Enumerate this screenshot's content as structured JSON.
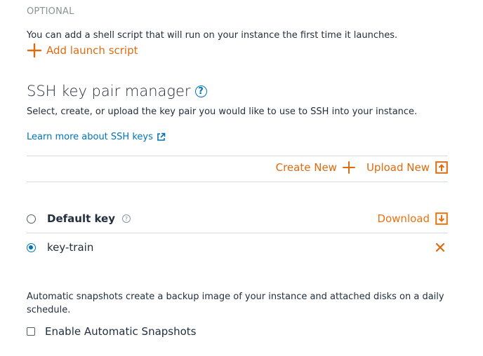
{
  "launch_script": {
    "section_label": "OPTIONAL",
    "description": "You can add a shell script that will run on your instance the first time it launches.",
    "add_label": "Add launch script"
  },
  "ssh": {
    "title": "SSH key pair manager",
    "help_glyph": "?",
    "description": "Select, create, or upload the key pair you would like to use to SSH into your instance.",
    "learn_more": "Learn more about SSH keys",
    "create_new": "Create New",
    "upload_new": "Upload New",
    "keys": [
      {
        "name": "Default key",
        "selected": false,
        "action": "Download",
        "help_glyph": "?"
      },
      {
        "name": "key-train",
        "selected": true
      }
    ]
  },
  "snapshots": {
    "description": "Automatic snapshots create a backup image of your instance and attached disks on a daily schedule.",
    "enable_label": "Enable Automatic Snapshots",
    "enabled": false
  },
  "colors": {
    "accent_orange": "#dd6b10",
    "link_blue": "#0073bb",
    "text": "#232f3e",
    "muted": "#879596",
    "divider": "#d5dbdb"
  },
  "icons": {
    "add": "plus-icon",
    "help": "help-circle-icon",
    "external": "external-link-icon",
    "upload": "upload-icon",
    "download": "download-icon",
    "remove": "close-icon"
  }
}
